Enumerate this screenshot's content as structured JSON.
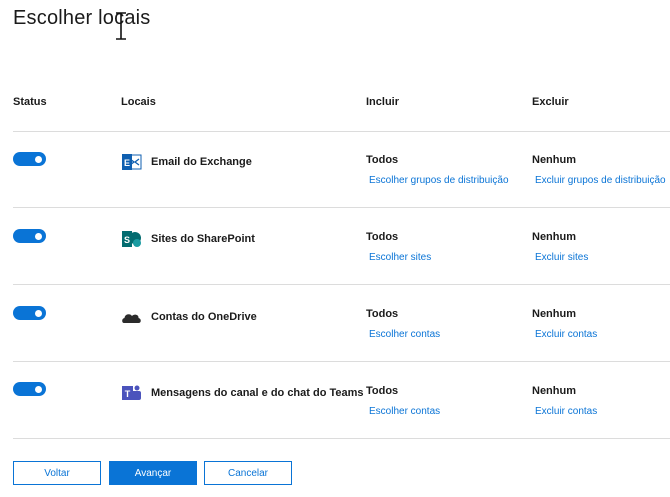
{
  "title": "Escolher locais",
  "columns": {
    "status": "Status",
    "locations": "Locais",
    "include": "Incluir",
    "exclude": "Excluir"
  },
  "rows": [
    {
      "enabled": true,
      "icon": "exchange-icon",
      "label": "Email do Exchange",
      "include_value": "Todos",
      "include_link": "Escolher grupos de distribuição",
      "exclude_value": "Nenhum",
      "exclude_link": "Excluir grupos de distribuição"
    },
    {
      "enabled": true,
      "icon": "sharepoint-icon",
      "label": "Sites do SharePoint",
      "include_value": "Todos",
      "include_link": "Escolher sites",
      "exclude_value": "Nenhum",
      "exclude_link": "Excluir sites"
    },
    {
      "enabled": true,
      "icon": "onedrive-icon",
      "label": "Contas do OneDrive",
      "include_value": "Todos",
      "include_link": "Escolher contas",
      "exclude_value": "Nenhum",
      "exclude_link": "Excluir contas"
    },
    {
      "enabled": true,
      "icon": "teams-icon",
      "label": "Mensagens do canal e do chat do Teams",
      "include_value": "Todos",
      "include_link": "Escolher contas",
      "exclude_value": "Nenhum",
      "exclude_link": "Excluir contas"
    }
  ],
  "buttons": {
    "back": "Voltar",
    "next": "Avançar",
    "cancel": "Cancelar"
  },
  "colors": {
    "accent": "#0a74d6",
    "exchange": "#0f5fb0",
    "sharepoint": "#036c70",
    "onedrive": "#2b2b2b",
    "teams": "#4b53bc"
  }
}
